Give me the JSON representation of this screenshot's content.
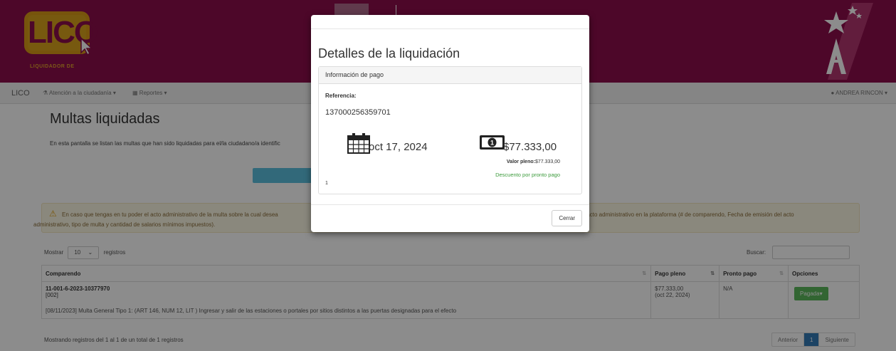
{
  "header": {
    "logo_text": "LICO",
    "logo_subtitle": "LIQUIDADOR DE"
  },
  "navbar": {
    "brand": "LICO",
    "menu_atencion": "Atención a la ciudadanía",
    "menu_reportes": "Reportes",
    "user": "ANDREA RINCON"
  },
  "page": {
    "title": "Multas liquidadas",
    "description": "En esta pantalla se listan las multas que han sido liquidadas para el/la ciudadano/a identific",
    "alert_text": "En caso que tengas en tu poder el acto administrativo de la multa sobre la cual desea",
    "alert_text_end": "ita el acto administrativo en la plataforma (# de comparendo, Fecha de emisión del acto",
    "alert_text_line2": "administrativo, tipo de multa y cantidad de salarios mínimos impuestos).",
    "show_label": "Mostrar",
    "show_value": "10",
    "records_label": "registros",
    "search_label": "Buscar:"
  },
  "table": {
    "headers": {
      "comparendo": "Comparendo",
      "pago_pleno": "Pago pleno",
      "pronto_pago": "Pronto pago",
      "opciones": "Opciones"
    },
    "rows": [
      {
        "comparendo": "11-001-6-2023-10377970",
        "code": "[002]",
        "pago_pleno": "$77.333,00",
        "pago_fecha": "(oct 22, 2024)",
        "pronto_pago": "N/A",
        "action": "Pagada",
        "detail": "[08/11/2023] Multa General Tipo 1: (ART 146, NUM 12, LIT ) Ingresar y salir de las estaciones o portales por sitios distintos a las puertas designadas para el efecto"
      }
    ],
    "info": "Mostrando registros del 1 al 1 de un total de 1 registros",
    "pager": {
      "prev": "Anterior",
      "page": "1",
      "next": "Siguiente"
    }
  },
  "modal": {
    "title": "Detalles de la liquidación",
    "panel_heading": "Información de pago",
    "ref_label": "Referencia:",
    "ref_value": "137000256359701",
    "date": "oct 17, 2024",
    "amount": "$77.333,00",
    "full_value_label": "Valor pleno:",
    "full_value": "$77.333,00",
    "discount_label": "Descuento por pronto pago",
    "panel_number": "1",
    "close_label": "Cerrar"
  },
  "icons": {
    "user_icon": "user-icon",
    "calendar": "calendar-icon",
    "money": "money-icon",
    "warning": "warning-icon"
  },
  "colors": {
    "header_bg": "#8d0d4b",
    "logo_gold": "#d9a31c",
    "success": "#5cb85c",
    "primary": "#337ab7",
    "info": "#5bc0de"
  }
}
